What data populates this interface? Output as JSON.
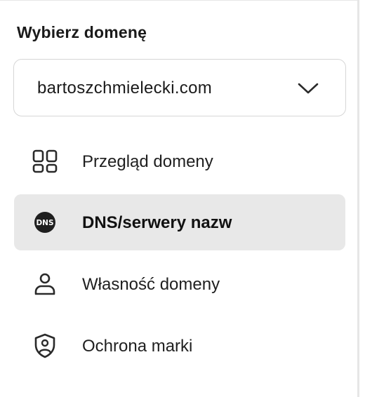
{
  "domain_panel": {
    "title": "Wybierz domenę",
    "selector": {
      "selected_value": "bartoszchmielecki.com",
      "icon": "chevron-down-icon"
    },
    "nav_items": [
      {
        "label": "Przegląd domeny",
        "icon": "grid-icon",
        "active": false
      },
      {
        "label": "DNS/serwery nazw",
        "icon": "dns-icon",
        "active": true,
        "icon_text": "DNS"
      },
      {
        "label": "Własność domeny",
        "icon": "user-icon",
        "active": false
      },
      {
        "label": "Ochrona marki",
        "icon": "shield-user-icon",
        "active": false
      }
    ]
  },
  "colors": {
    "active_background": "#e8e8e8",
    "text": "#1a1a1a",
    "border": "#d6d6d6"
  }
}
